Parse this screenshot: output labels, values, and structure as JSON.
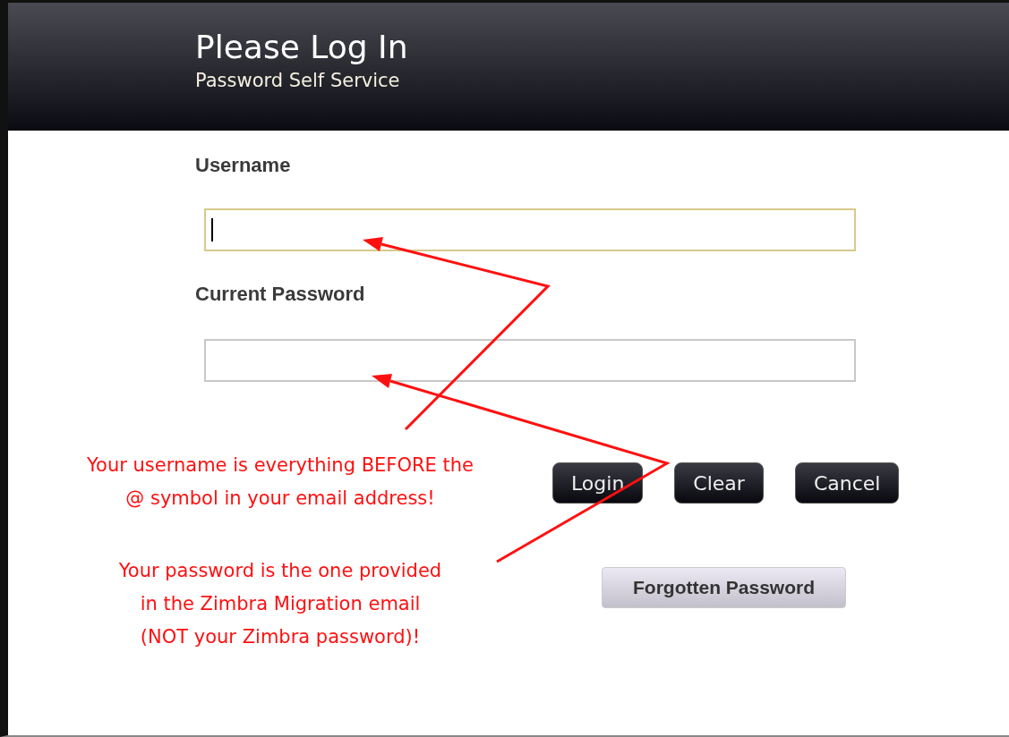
{
  "header": {
    "title": "Please Log In",
    "subtitle": "Password Self Service"
  },
  "fields": [
    {
      "label": "Username",
      "focused": true
    },
    {
      "label": "Current Password",
      "focused": false
    }
  ],
  "buttons": [
    "Login",
    "Clear",
    "Cancel"
  ],
  "secondary_button": "Forgotten Password",
  "notes": [
    [
      "Your username is everything BEFORE the",
      "@ symbol in your email address!"
    ],
    [
      "Your password is the one provided",
      "in the Zimbra Migration email",
      "(NOT your Zimbra password)!"
    ]
  ]
}
